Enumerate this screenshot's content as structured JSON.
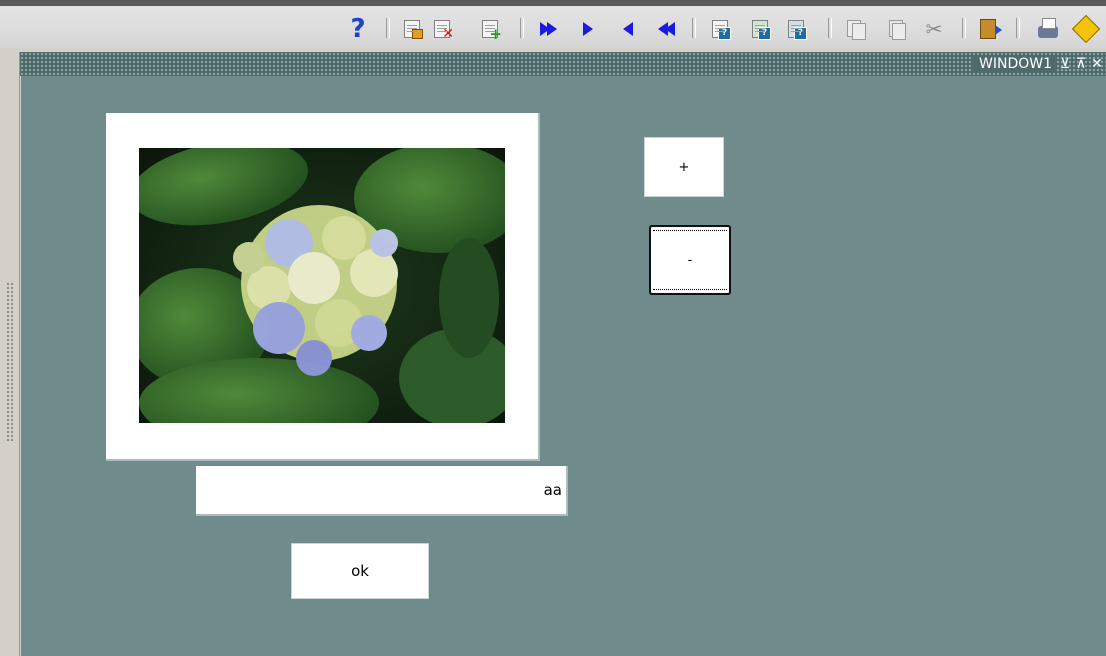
{
  "toolbar": {
    "icons": [
      "help-icon",
      "save-icon",
      "delete-record-icon",
      "insert-record-icon",
      "previous-block-icon",
      "previous-record-icon",
      "next-record-icon",
      "next-block-icon",
      "enter-query-icon",
      "execute-query-icon",
      "cancel-query-icon",
      "copy-icon",
      "paste-icon",
      "cut-icon",
      "exit-icon",
      "print-icon",
      "clear-icon"
    ],
    "help_label": "?"
  },
  "window": {
    "title": "WINDOW1",
    "minimize_symbol": "⊻",
    "maximize_symbol": "⊼",
    "close_symbol": "✕"
  },
  "form": {
    "text_field_value": "aa",
    "plus_label": "+",
    "minus_label": "-",
    "ok_label": "ok"
  },
  "colors": {
    "canvas": "#6f8b8b",
    "titlebar": "#4e6a6a",
    "toolbar": "#d6d6d6"
  }
}
